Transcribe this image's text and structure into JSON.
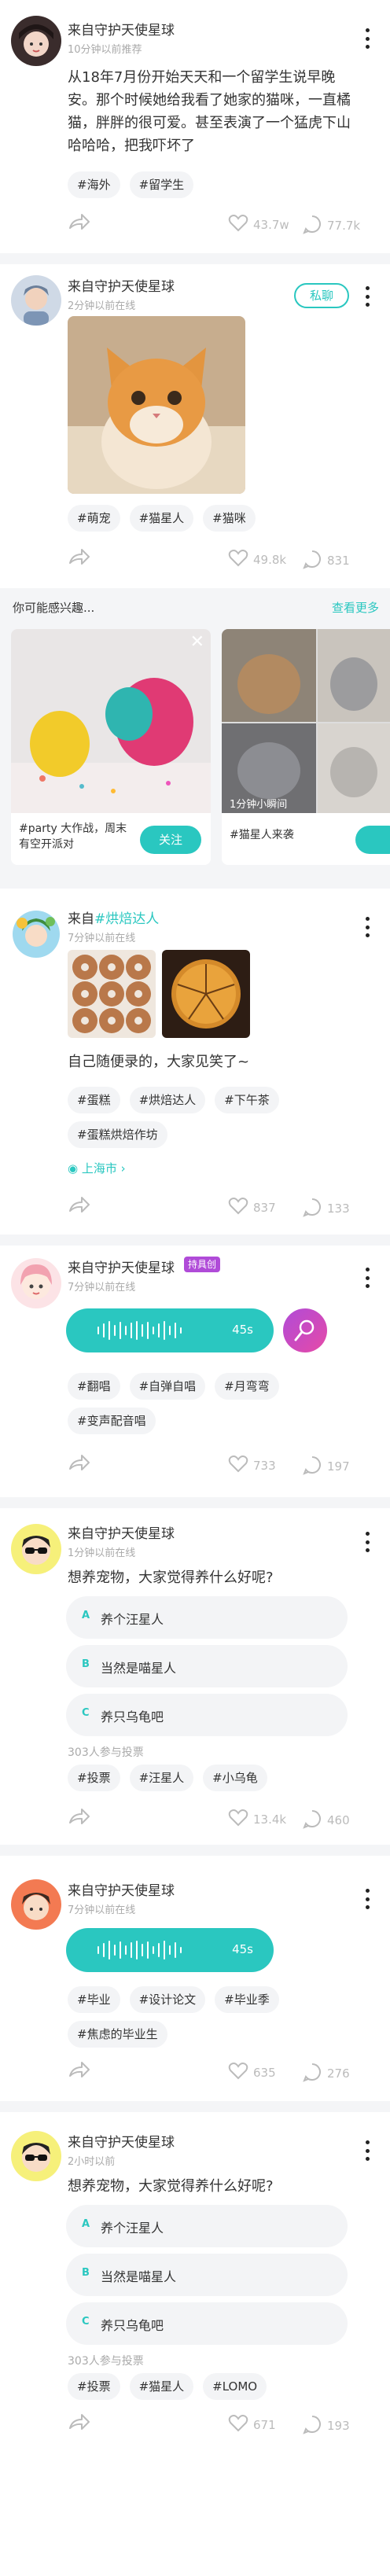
{
  "posts": [
    {
      "user": "来自守护天使星球",
      "time": "10分钟以前推荐",
      "text": "从18年7月份开始天天和一个留学生说早晚安。那个时候她给我看了她家的猫咪，一直橘猫，胖胖的很可爱。甚至表演了一个猛虎下山哈哈哈，把我吓坏了",
      "tags": [
        "#海外",
        "#留学生"
      ],
      "likes": "43.7w",
      "comments": "77.7k"
    },
    {
      "user": "来自守护天使星球",
      "time": "2分钟以前在线",
      "chat_label": "私聊",
      "tags": [
        "#萌宠",
        "#猫星人",
        "#猫咪"
      ],
      "likes": "49.8k",
      "comments": "831"
    },
    {
      "user_prefix": "来自",
      "user_highlight": "#烘焙达人",
      "time": "7分钟以前在线",
      "text": "自己随便录的，大家见笑了~",
      "tags": [
        "#蛋糕",
        "#烘焙达人",
        "#下午茶",
        "#蛋糕烘焙作坊"
      ],
      "location": "上海市",
      "likes": "837",
      "comments": "133"
    },
    {
      "user": "来自守护天使星球",
      "badge": "持具创",
      "time": "7分钟以前在线",
      "voice_duration": "45s",
      "tags": [
        "#翻唱",
        "#自弹自唱",
        "#月弯弯",
        "#变声配音唱"
      ],
      "likes": "733",
      "comments": "197"
    },
    {
      "user": "来自守护天使星球",
      "time": "1分钟以前在线",
      "question": "想养宠物，大家觉得养什么好呢?",
      "options": [
        {
          "letter": "A",
          "text": "养个汪星人"
        },
        {
          "letter": "B",
          "text": "当然是喵星人"
        },
        {
          "letter": "C",
          "text": "养只乌龟吧"
        }
      ],
      "vote_count": "303人参与投票",
      "tags": [
        "#投票",
        "#汪星人",
        "#小乌龟"
      ],
      "likes": "13.4k",
      "comments": "460"
    },
    {
      "user": "来自守护天使星球",
      "time": "7分钟以前在线",
      "voice_duration": "45s",
      "tags": [
        "#毕业",
        "#设计论文",
        "#毕业季",
        "#焦虑的毕业生"
      ],
      "likes": "635",
      "comments": "276"
    },
    {
      "user": "来自守护天使星球",
      "time": "2小时以前",
      "question": "想养宠物，大家觉得养什么好呢?",
      "options": [
        {
          "letter": "A",
          "text": "养个汪星人"
        },
        {
          "letter": "B",
          "text": "当然是喵星人"
        },
        {
          "letter": "C",
          "text": "养只乌龟吧"
        }
      ],
      "vote_count": "303人参与投票",
      "tags": [
        "#投票",
        "#猫星人",
        "#LOMO"
      ],
      "likes": "671",
      "comments": "193"
    }
  ],
  "recommend": {
    "title": "你可能感兴趣...",
    "see_more": "查看更多",
    "cards": [
      {
        "caption": "#party 大作战，周末有空开派对",
        "follow": "关注"
      },
      {
        "caption": "#猫星人来袭",
        "overlay": "1分钟小瞬间"
      }
    ]
  },
  "colors": {
    "accent": "#2ac7c0",
    "purple": "#b04bd8",
    "bg": "#f4f5f7"
  }
}
